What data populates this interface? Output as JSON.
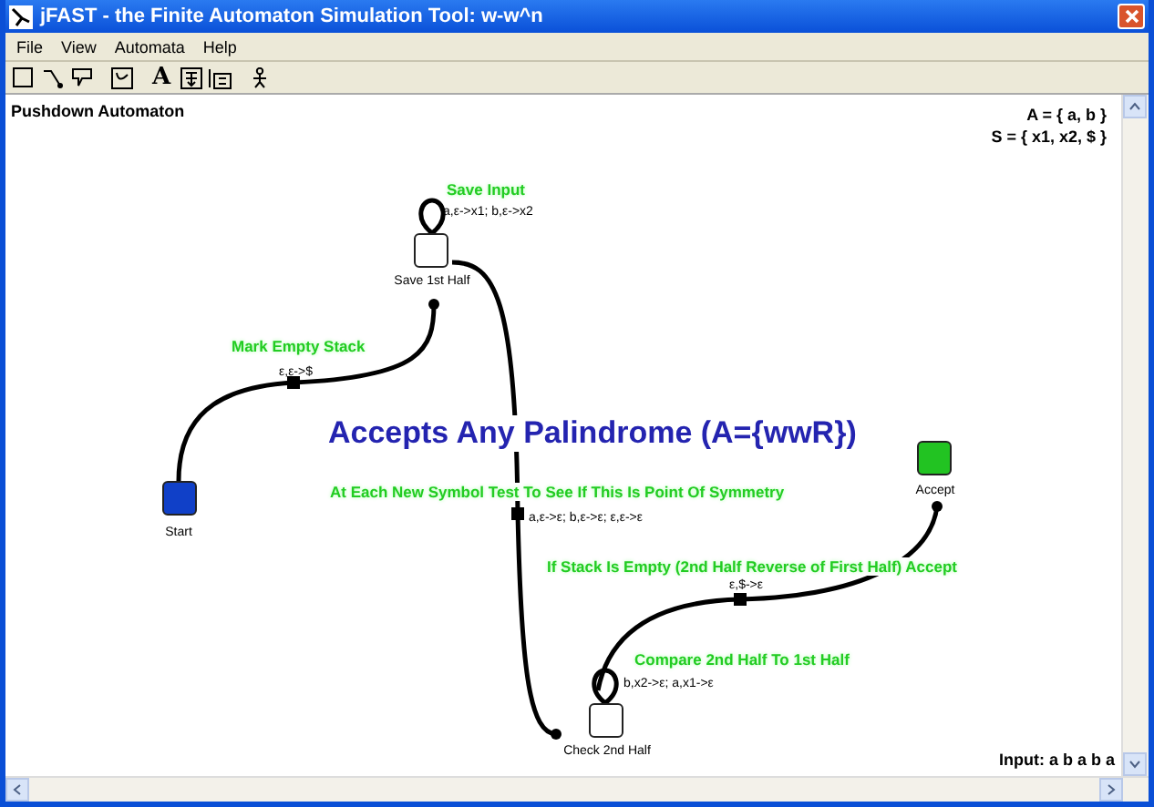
{
  "window": {
    "title": "jFAST - the Finite Automaton Simulation Tool: w-w^n"
  },
  "menu": [
    "File",
    "View",
    "Automata",
    "Help"
  ],
  "toolbar": [
    {
      "kind": "state"
    },
    {
      "kind": "transition"
    },
    {
      "kind": "note"
    },
    {
      "kind": "select"
    },
    {
      "kind": "text",
      "label": "A"
    },
    {
      "kind": "group"
    },
    {
      "kind": "block"
    },
    {
      "kind": "run"
    }
  ],
  "canvas": {
    "mode": "Pushdown Automaton",
    "alphabet": "A = { a, b }",
    "stack_alphabet": "S = { x1, x2, $ }",
    "heading": "Accepts Any Palindrome (A={wwR})",
    "input": "Input: a b a b a",
    "states": [
      {
        "name": "Start",
        "kind": "start"
      },
      {
        "name": "Save 1st Half",
        "kind": "normal"
      },
      {
        "name": "Check 2nd Half",
        "kind": "normal"
      },
      {
        "name": "Accept",
        "kind": "accept"
      }
    ],
    "transitions": [
      {
        "label": "ε,ε->$",
        "kind": "edge"
      },
      {
        "label": "a,ε->x1; b,ε->x2",
        "kind": "loop"
      },
      {
        "label": "a,ε->ε; b,ε->ε; ε,ε->ε",
        "kind": "edge"
      },
      {
        "label": "b,x2->ε; a,x1->ε",
        "kind": "loop"
      },
      {
        "label": "ε,$->ε",
        "kind": "edge"
      }
    ],
    "notes": [
      "Save Input",
      "Mark Empty Stack",
      "At Each New Symbol Test To See If This Is Point Of Symmetry",
      "If Stack Is Empty (2nd Half Reverse of First Half) Accept",
      "Compare 2nd Half To 1st Half"
    ]
  }
}
